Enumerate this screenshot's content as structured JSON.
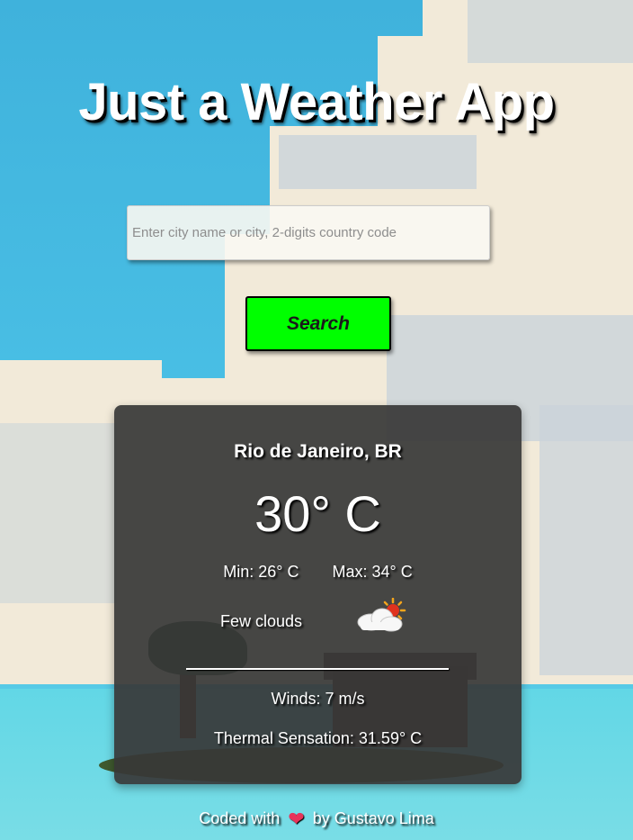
{
  "app": {
    "title": "Just a Weather App"
  },
  "search": {
    "placeholder": "Enter city name or city, 2-digits country code",
    "value": "",
    "button_label": "Search",
    "button_color": "#00ff00"
  },
  "weather": {
    "location": "Rio de Janeiro, BR",
    "temperature": "30° C",
    "min": "Min: 26° C",
    "max": "Max: 34° C",
    "description": "Few clouds",
    "icon": "few-clouds-icon",
    "winds": "Winds: 7 m/s",
    "thermal_sensation": "Thermal Sensation: 31.59° C"
  },
  "footer": {
    "prefix": "Coded with",
    "heart": "❤",
    "suffix": "by Gustavo Lima"
  }
}
